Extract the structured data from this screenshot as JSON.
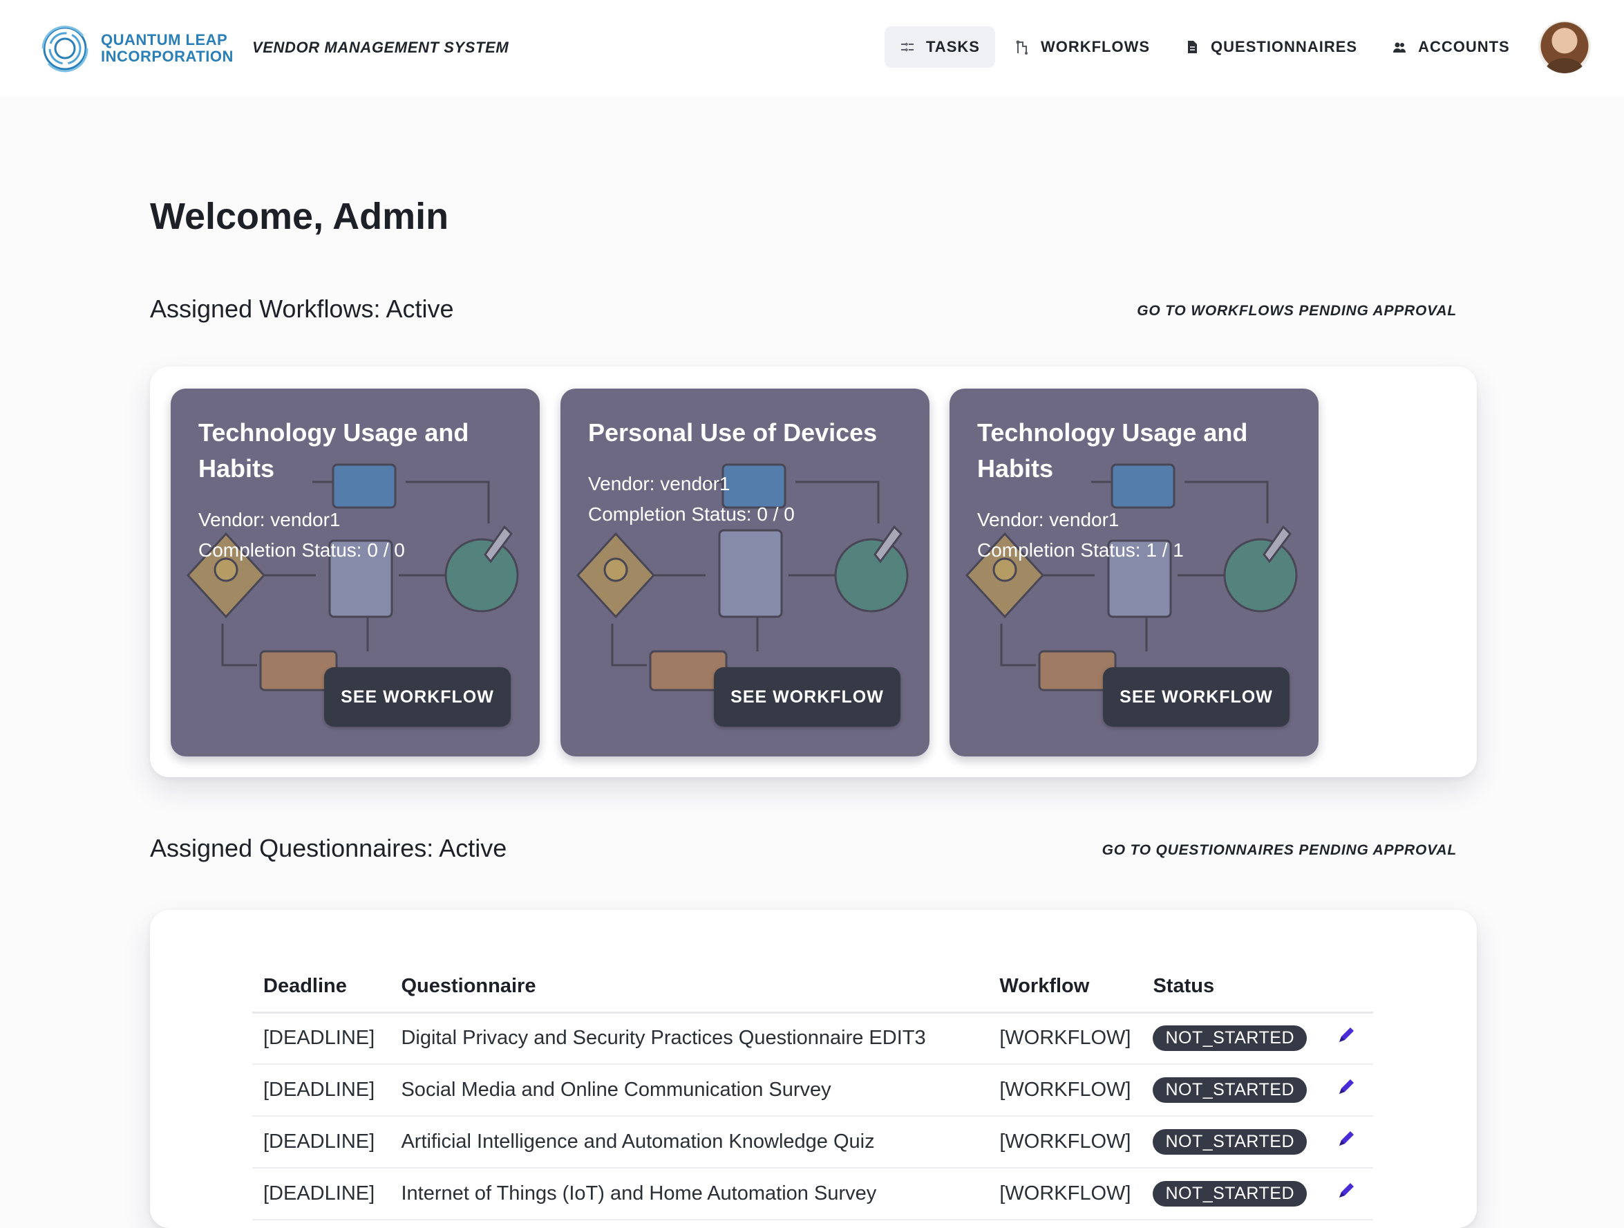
{
  "brand": {
    "line1": "QUANTUM LEAP",
    "line2": "INCORPORATION",
    "system_name": "VENDOR MANAGEMENT SYSTEM"
  },
  "nav": {
    "items": [
      {
        "label": "TASKS",
        "icon": "tasks-icon",
        "active": true
      },
      {
        "label": "WORKFLOWS",
        "icon": "workflow-icon",
        "active": false
      },
      {
        "label": "QUESTIONNAIRES",
        "icon": "document-icon",
        "active": false
      },
      {
        "label": "ACCOUNTS",
        "icon": "users-icon",
        "active": false
      }
    ]
  },
  "welcome": "Welcome, Admin",
  "workflows_section": {
    "title": "Assigned Workflows: Active",
    "link": "GO TO WORKFLOWS PENDING APPROVAL",
    "cards": [
      {
        "title": "Technology Usage and Habits",
        "vendor": "Vendor: vendor1",
        "status": "Completion Status: 0 / 0",
        "button": "SEE WORKFLOW"
      },
      {
        "title": "Personal Use of Devices",
        "vendor": "Vendor: vendor1",
        "status": "Completion Status: 0 / 0",
        "button": "SEE WORKFLOW"
      },
      {
        "title": "Technology Usage and Habits",
        "vendor": "Vendor: vendor1",
        "status": "Completion Status: 1 / 1",
        "button": "SEE WORKFLOW"
      }
    ]
  },
  "questionnaires_section": {
    "title": "Assigned Questionnaires: Active",
    "link": "GO TO QUESTIONNAIRES PENDING APPROVAL",
    "columns": [
      "Deadline",
      "Questionnaire",
      "Workflow",
      "Status"
    ],
    "rows": [
      {
        "deadline": "[DEADLINE]",
        "questionnaire": "Digital Privacy and Security Practices Questionnaire EDIT3",
        "workflow": "[WORKFLOW]",
        "status": "NOT_STARTED"
      },
      {
        "deadline": "[DEADLINE]",
        "questionnaire": "Social Media and Online Communication Survey",
        "workflow": "[WORKFLOW]",
        "status": "NOT_STARTED"
      },
      {
        "deadline": "[DEADLINE]",
        "questionnaire": "Artificial Intelligence and Automation Knowledge Quiz",
        "workflow": "[WORKFLOW]",
        "status": "NOT_STARTED"
      },
      {
        "deadline": "[DEADLINE]",
        "questionnaire": "Internet of Things (IoT) and Home Automation Survey",
        "workflow": "[WORKFLOW]",
        "status": "NOT_STARTED"
      }
    ]
  },
  "colors": {
    "brand": "#2a7fb8",
    "card": "#6e6983",
    "button": "#353a46",
    "edit_icon": "#4a2bd6"
  }
}
